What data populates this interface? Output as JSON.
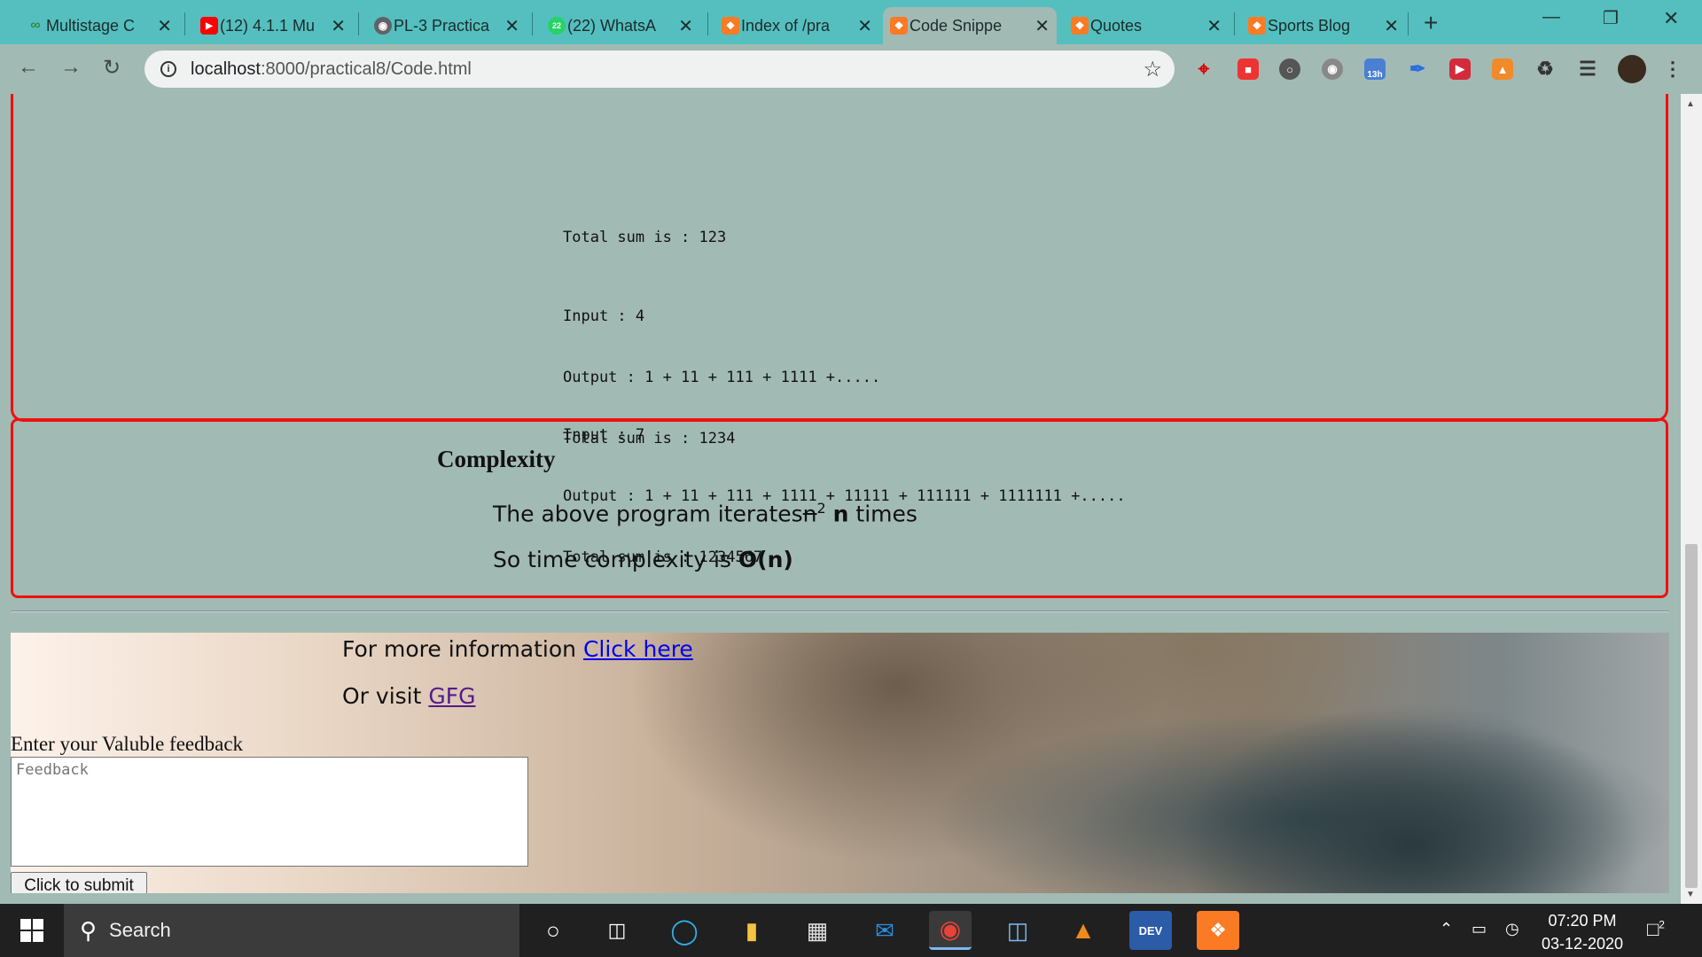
{
  "browser": {
    "tabs": [
      {
        "label": "Multistage C",
        "icon": "gfg-icon",
        "color": "#2f8d46"
      },
      {
        "label": "(12) 4.1.1 Mu",
        "icon": "youtube-icon",
        "color": "#ff0000"
      },
      {
        "label": "PL-3 Practica",
        "icon": "globe-icon",
        "color": "#5f6368"
      },
      {
        "label": "(22) WhatsA",
        "icon": "whatsapp-icon",
        "color": "#25d366",
        "badge": "22"
      },
      {
        "label": "Index of /pra",
        "icon": "xampp-icon",
        "color": "#fb7a24"
      },
      {
        "label": "Code Snippe",
        "icon": "xampp-icon",
        "color": "#fb7a24",
        "active": true
      },
      {
        "label": "Quotes",
        "icon": "xampp-icon",
        "color": "#fb7a24"
      },
      {
        "label": "Sports Blog",
        "icon": "xampp-icon",
        "color": "#fb7a24"
      }
    ],
    "new_tab": "+",
    "url_host": "localhost",
    "url_path": ":8000/practical8/Code.html",
    "extension_badge": "13h"
  },
  "page": {
    "code_lines_1": [
      "Total sum is : 123"
    ],
    "code_lines_2": [
      "Input : 4",
      "Output : 1 + 11 + 111 + 1111 +.....",
      "Total sum is : 1234"
    ],
    "code_lines_3": [
      "Input : 7",
      "Output : 1 + 11 + 111 + 1111 + 11111 + 111111 + 1111111 +.....",
      "Total sum is : 1234567"
    ],
    "complexity": {
      "title": "Complexity",
      "line1_prefix": "The above program iterates",
      "line1_struck": "n",
      "line1_sup": "2",
      "line1_bold": "n",
      "line1_suffix": " times",
      "line2_prefix": "So time complexity is ",
      "line2_bold": "O(n)"
    },
    "footer": {
      "info_prefix": "For more information ",
      "info_link": "Click here",
      "visit_prefix": "Or visit ",
      "visit_link": "GFG",
      "feedback_label": "Enter your Valuble feedback",
      "feedback_placeholder": "Feedback",
      "submit_label": "Click to submit"
    }
  },
  "taskbar": {
    "search_text": "Search",
    "time": "07:20 PM",
    "date": "03-12-2020",
    "notification_count": "2"
  }
}
